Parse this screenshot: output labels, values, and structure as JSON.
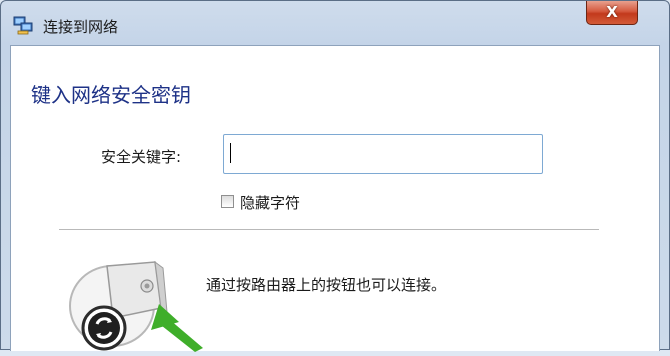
{
  "window": {
    "title": "连接到网络",
    "close_label": "X"
  },
  "dialog": {
    "heading": "键入网络安全密钥",
    "security_key_label": "安全关键字:",
    "security_key_value": "",
    "hide_characters_label": "隐藏字符",
    "hide_characters_checked": false,
    "router_hint": "通过按路由器上的按钮也可以连接。"
  },
  "icons": {
    "app": "network-connect-icon",
    "close": "close-icon",
    "router": "router-push-button-icon"
  },
  "colors": {
    "heading": "#1e3287",
    "close_button": "#c2391c",
    "input_border": "#7ea9d3",
    "arrow": "#3fae2a"
  }
}
